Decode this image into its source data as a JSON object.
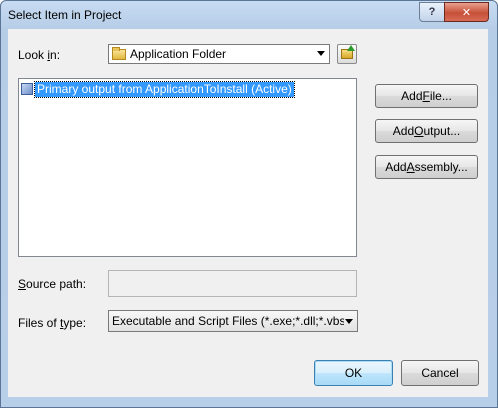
{
  "window": {
    "title": "Select Item in Project",
    "help_label": "?",
    "close_label": "✕"
  },
  "look_in": {
    "label_pre": "Look ",
    "label_accel": "i",
    "label_post": "n:",
    "value": "Application Folder",
    "icon": "folder-icon"
  },
  "items": [
    {
      "label": "Primary output from ApplicationToInstall (Active)",
      "icon": "output-icon",
      "selected": true
    }
  ],
  "buttons": {
    "add_file": {
      "pre": "Add ",
      "accel": "F",
      "post": "ile..."
    },
    "add_output": {
      "pre": "Add ",
      "accel": "O",
      "post": "utput..."
    },
    "add_assembly": {
      "pre": "Add ",
      "accel": "A",
      "post": "ssembly..."
    },
    "ok": "OK",
    "cancel": "Cancel"
  },
  "source_path": {
    "label_pre": "",
    "label_accel": "S",
    "label_post": "ource path:",
    "value": ""
  },
  "files_of_type": {
    "label_pre": "Files of ",
    "label_accel": "t",
    "label_post": "ype:",
    "value": "Executable and Script Files (*.exe;*.dll;*.vbs;"
  },
  "colors": {
    "selection": "#3399ff",
    "title_gradient": "#c8dcf2",
    "close_button": "#c7503a"
  }
}
